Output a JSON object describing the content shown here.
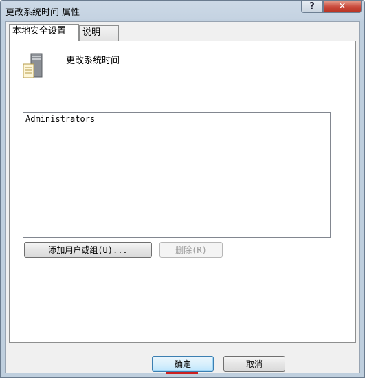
{
  "window": {
    "title": "更改系统时间 属性",
    "help_label": "?",
    "close_label": "✕"
  },
  "tabs": [
    {
      "label": "本地安全设置",
      "active": true
    },
    {
      "label": "说明",
      "active": false
    }
  ],
  "policy": {
    "name": "更改系统时间",
    "icon": "policy-server-icon"
  },
  "members": {
    "items": [
      "Administrators"
    ]
  },
  "buttons": {
    "add": "添加用户或组(U)...",
    "remove": "删除(R)",
    "ok": "确定",
    "cancel": "取消"
  },
  "colors": {
    "ok_underline": "#cc1f1f",
    "close_button": "#c8483a"
  }
}
